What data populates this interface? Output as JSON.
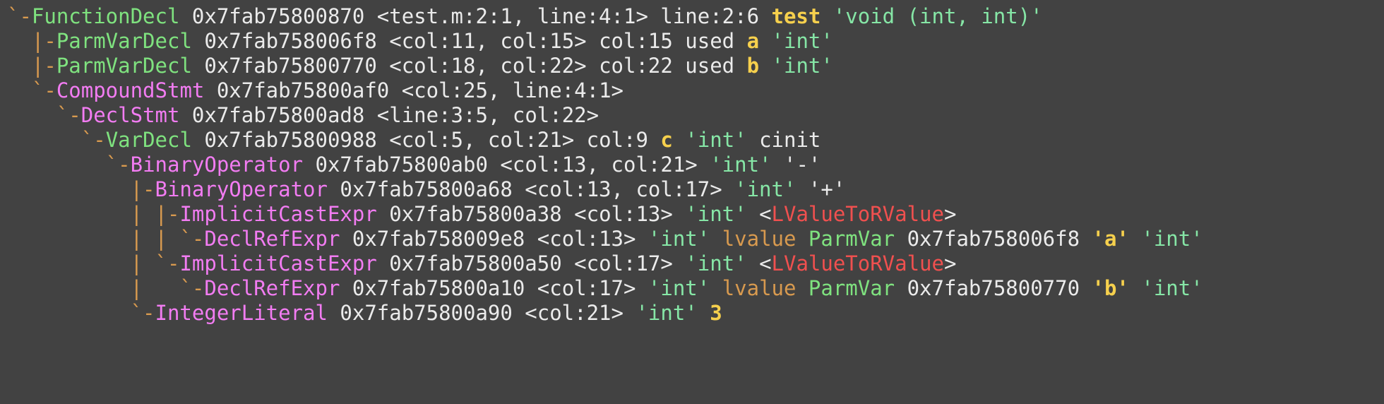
{
  "colors": {
    "background": "#424242",
    "tree": "#d89a4f",
    "decl_green": "#7fe27f",
    "stmt_magenta": "#f27cf2",
    "plain": "#ebebeb",
    "type_string": "#86e6a6",
    "name_yellow": "#f6d04d",
    "cast_red": "#f0504f"
  },
  "lines": [
    {
      "segments": [
        {
          "text": "`-",
          "style": "tree"
        },
        {
          "text": "FunctionDecl",
          "style": "green"
        },
        {
          "text": " 0x7fab75800870 <test.m:2:1, line:4:1> line:2:6 ",
          "style": "plain"
        },
        {
          "text": "test",
          "style": "yel"
        },
        {
          "text": " ",
          "style": "plain"
        },
        {
          "text": "'void (int, int)'",
          "style": "str"
        }
      ]
    },
    {
      "segments": [
        {
          "text": "  |-",
          "style": "tree"
        },
        {
          "text": "ParmVarDecl",
          "style": "green"
        },
        {
          "text": " 0x7fab758006f8 <col:11, col:15> col:15 used ",
          "style": "plain"
        },
        {
          "text": "a",
          "style": "yel"
        },
        {
          "text": " ",
          "style": "plain"
        },
        {
          "text": "'int'",
          "style": "str"
        }
      ]
    },
    {
      "segments": [
        {
          "text": "  |-",
          "style": "tree"
        },
        {
          "text": "ParmVarDecl",
          "style": "green"
        },
        {
          "text": " 0x7fab75800770 <col:18, col:22> col:22 used ",
          "style": "plain"
        },
        {
          "text": "b",
          "style": "yel"
        },
        {
          "text": " ",
          "style": "plain"
        },
        {
          "text": "'int'",
          "style": "str"
        }
      ]
    },
    {
      "segments": [
        {
          "text": "  `-",
          "style": "tree"
        },
        {
          "text": "CompoundStmt",
          "style": "mag"
        },
        {
          "text": " 0x7fab75800af0 <col:25, line:4:1>",
          "style": "plain"
        }
      ]
    },
    {
      "segments": [
        {
          "text": "    `-",
          "style": "tree"
        },
        {
          "text": "DeclStmt",
          "style": "mag"
        },
        {
          "text": " 0x7fab75800ad8 <line:3:5, col:22>",
          "style": "plain"
        }
      ]
    },
    {
      "segments": [
        {
          "text": "      `-",
          "style": "tree"
        },
        {
          "text": "VarDecl",
          "style": "green"
        },
        {
          "text": " 0x7fab75800988 <col:5, col:21> col:9 ",
          "style": "plain"
        },
        {
          "text": "c",
          "style": "yel"
        },
        {
          "text": " ",
          "style": "plain"
        },
        {
          "text": "'int'",
          "style": "str"
        },
        {
          "text": " cinit",
          "style": "plain"
        }
      ]
    },
    {
      "segments": [
        {
          "text": "        `-",
          "style": "tree"
        },
        {
          "text": "BinaryOperator",
          "style": "mag"
        },
        {
          "text": " 0x7fab75800ab0 <col:13, col:21> ",
          "style": "plain"
        },
        {
          "text": "'int'",
          "style": "str"
        },
        {
          "text": " ",
          "style": "plain"
        },
        {
          "text": "'-'",
          "style": "plain"
        }
      ]
    },
    {
      "segments": [
        {
          "text": "          |-",
          "style": "tree"
        },
        {
          "text": "BinaryOperator",
          "style": "mag"
        },
        {
          "text": " 0x7fab75800a68 <col:13, col:17> ",
          "style": "plain"
        },
        {
          "text": "'int'",
          "style": "str"
        },
        {
          "text": " ",
          "style": "plain"
        },
        {
          "text": "'+'",
          "style": "plain"
        }
      ]
    },
    {
      "segments": [
        {
          "text": "          | |-",
          "style": "tree"
        },
        {
          "text": "ImplicitCastExpr",
          "style": "mag"
        },
        {
          "text": " 0x7fab75800a38 <col:13> ",
          "style": "plain"
        },
        {
          "text": "'int'",
          "style": "str"
        },
        {
          "text": " <",
          "style": "plain"
        },
        {
          "text": "LValueToRValue",
          "style": "red"
        },
        {
          "text": ">",
          "style": "plain"
        }
      ]
    },
    {
      "segments": [
        {
          "text": "          | | `-",
          "style": "tree"
        },
        {
          "text": "DeclRefExpr",
          "style": "mag"
        },
        {
          "text": " 0x7fab758009e8 <col:13> ",
          "style": "plain"
        },
        {
          "text": "'int'",
          "style": "str"
        },
        {
          "text": " lvalue ",
          "style": "tree"
        },
        {
          "text": "ParmVar",
          "style": "green"
        },
        {
          "text": " 0x7fab758006f8 ",
          "style": "plain"
        },
        {
          "text": "'a'",
          "style": "yel"
        },
        {
          "text": " ",
          "style": "plain"
        },
        {
          "text": "'int'",
          "style": "str"
        }
      ]
    },
    {
      "segments": [
        {
          "text": "          | `-",
          "style": "tree"
        },
        {
          "text": "ImplicitCastExpr",
          "style": "mag"
        },
        {
          "text": " 0x7fab75800a50 <col:17> ",
          "style": "plain"
        },
        {
          "text": "'int'",
          "style": "str"
        },
        {
          "text": " <",
          "style": "plain"
        },
        {
          "text": "LValueToRValue",
          "style": "red"
        },
        {
          "text": ">",
          "style": "plain"
        }
      ]
    },
    {
      "segments": [
        {
          "text": "          |   `-",
          "style": "tree"
        },
        {
          "text": "DeclRefExpr",
          "style": "mag"
        },
        {
          "text": " 0x7fab75800a10 <col:17> ",
          "style": "plain"
        },
        {
          "text": "'int'",
          "style": "str"
        },
        {
          "text": " lvalue ",
          "style": "tree"
        },
        {
          "text": "ParmVar",
          "style": "green"
        },
        {
          "text": " 0x7fab75800770 ",
          "style": "plain"
        },
        {
          "text": "'b'",
          "style": "yel"
        },
        {
          "text": " ",
          "style": "plain"
        },
        {
          "text": "'int'",
          "style": "str"
        }
      ]
    },
    {
      "segments": [
        {
          "text": "          `-",
          "style": "tree"
        },
        {
          "text": "IntegerLiteral",
          "style": "mag"
        },
        {
          "text": " 0x7fab75800a90 <col:21> ",
          "style": "plain"
        },
        {
          "text": "'int'",
          "style": "str"
        },
        {
          "text": " ",
          "style": "plain"
        },
        {
          "text": "3",
          "style": "yel"
        }
      ]
    }
  ]
}
